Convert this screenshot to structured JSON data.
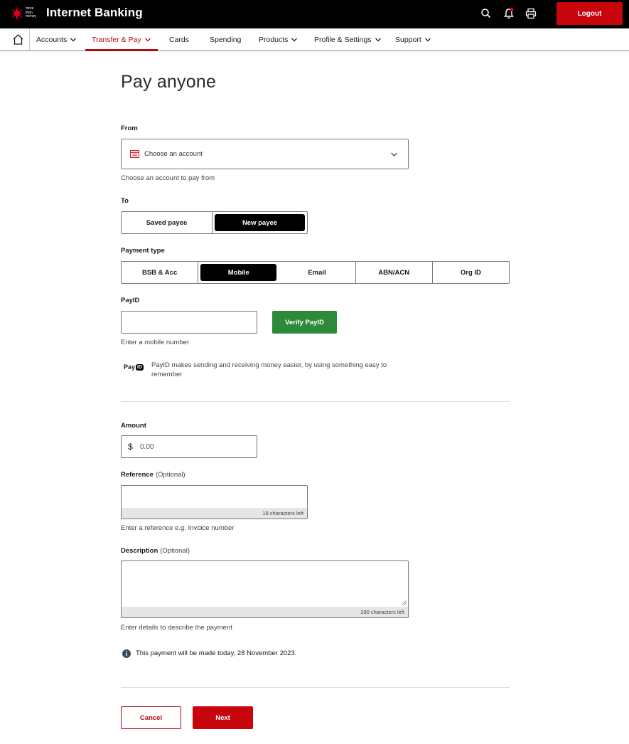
{
  "header": {
    "logo_text": "more than money",
    "app_title": "Internet Banking",
    "logout_label": "Logout",
    "brand_color": "#c8040c"
  },
  "nav": {
    "items": [
      {
        "label": "Accounts"
      },
      {
        "label": "Transfer & Pay",
        "active": true
      },
      {
        "label": "Cards"
      },
      {
        "label": "Spending"
      },
      {
        "label": "Products"
      },
      {
        "label": "Profile & Settings"
      },
      {
        "label": "Support"
      }
    ]
  },
  "page": {
    "title": "Pay anyone",
    "from": {
      "label": "From",
      "placeholder": "Choose an account",
      "hint": "Choose an account to pay from"
    },
    "to": {
      "label": "To",
      "options": [
        "Saved payee",
        "New payee"
      ],
      "selected": "New payee"
    },
    "payment_type": {
      "label": "Payment type",
      "options": [
        "BSB & Acc",
        "Mobile",
        "Email",
        "ABN/ACN",
        "Org ID"
      ],
      "selected": "Mobile"
    },
    "payid": {
      "label": "PayID",
      "value": "",
      "verify_label": "Verify PayID",
      "hint": "Enter a mobile number",
      "logo_pay": "Pay",
      "logo_id": "ID",
      "info": "PayID makes sending and receiving money easier, by using something easy to remember"
    },
    "amount": {
      "label": "Amount",
      "currency": "$",
      "placeholder": "0.00"
    },
    "reference": {
      "label": "Reference",
      "optional": "(Optional)",
      "counter": "18 characters left",
      "hint": "Enter a reference e.g. Invoice number"
    },
    "description": {
      "label": "Description",
      "optional": "(Optional)",
      "counter": "280 characters left",
      "hint": "Enter details to describe the payment"
    },
    "notice": "This payment will be made today, 28 November 2023.",
    "cancel_label": "Cancel",
    "next_label": "Next"
  }
}
